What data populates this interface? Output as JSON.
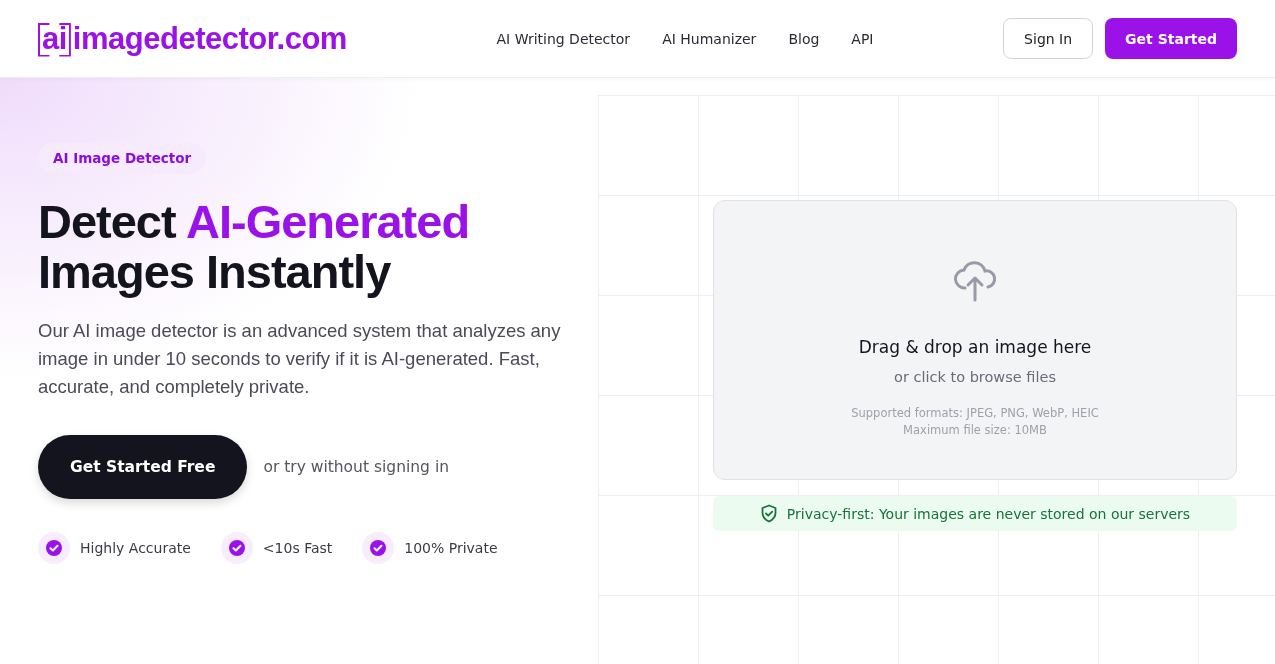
{
  "header": {
    "logo": {
      "mark": "ai",
      "name": "imagedetector.com"
    },
    "nav": [
      "AI Writing Detector",
      "AI Humanizer",
      "Blog",
      "API"
    ],
    "sign_in": "Sign In",
    "get_started": "Get Started"
  },
  "hero": {
    "badge": "AI Image Detector",
    "title_start": "Detect ",
    "title_highlight": "AI-Generated",
    "title_end": "Images Instantly",
    "description": "Our AI image detector is an advanced system that analyzes any image in under 10 seconds to verify if it is AI-generated. Fast, accurate, and completely private.",
    "cta": "Get Started Free",
    "cta_note": "or try without signing in",
    "features": [
      "Highly Accurate",
      "<10s Fast",
      "100% Private"
    ]
  },
  "upload": {
    "title": "Drag & drop an image here",
    "subtitle": "or click to browse files",
    "formats": "Supported formats: JPEG, PNG, WebP, HEIC",
    "max_size": "Maximum file size: 10MB"
  },
  "privacy_note": "Privacy-first: Your images are never stored on our servers"
}
